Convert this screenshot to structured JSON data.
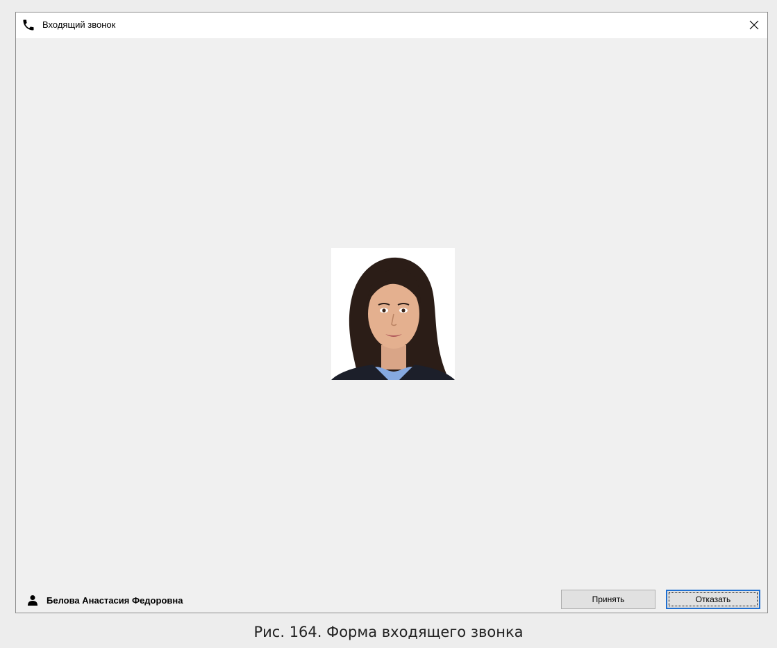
{
  "window": {
    "title": "Входящий звонок",
    "title_icon": "phone-icon",
    "close_icon": "close-icon"
  },
  "caller": {
    "icon": "user-icon",
    "name": "Белова Анастасия Федоровна",
    "photo": "caller-photo"
  },
  "buttons": {
    "accept": "Принять",
    "decline": "Отказать"
  },
  "caption": "Рис. 164. Форма входящего звонка",
  "colors": {
    "window_bg": "#f0f0f0",
    "titlebar_bg": "#ffffff",
    "focus_border": "#1f6fd0",
    "button_bg": "#e1e1e1"
  }
}
